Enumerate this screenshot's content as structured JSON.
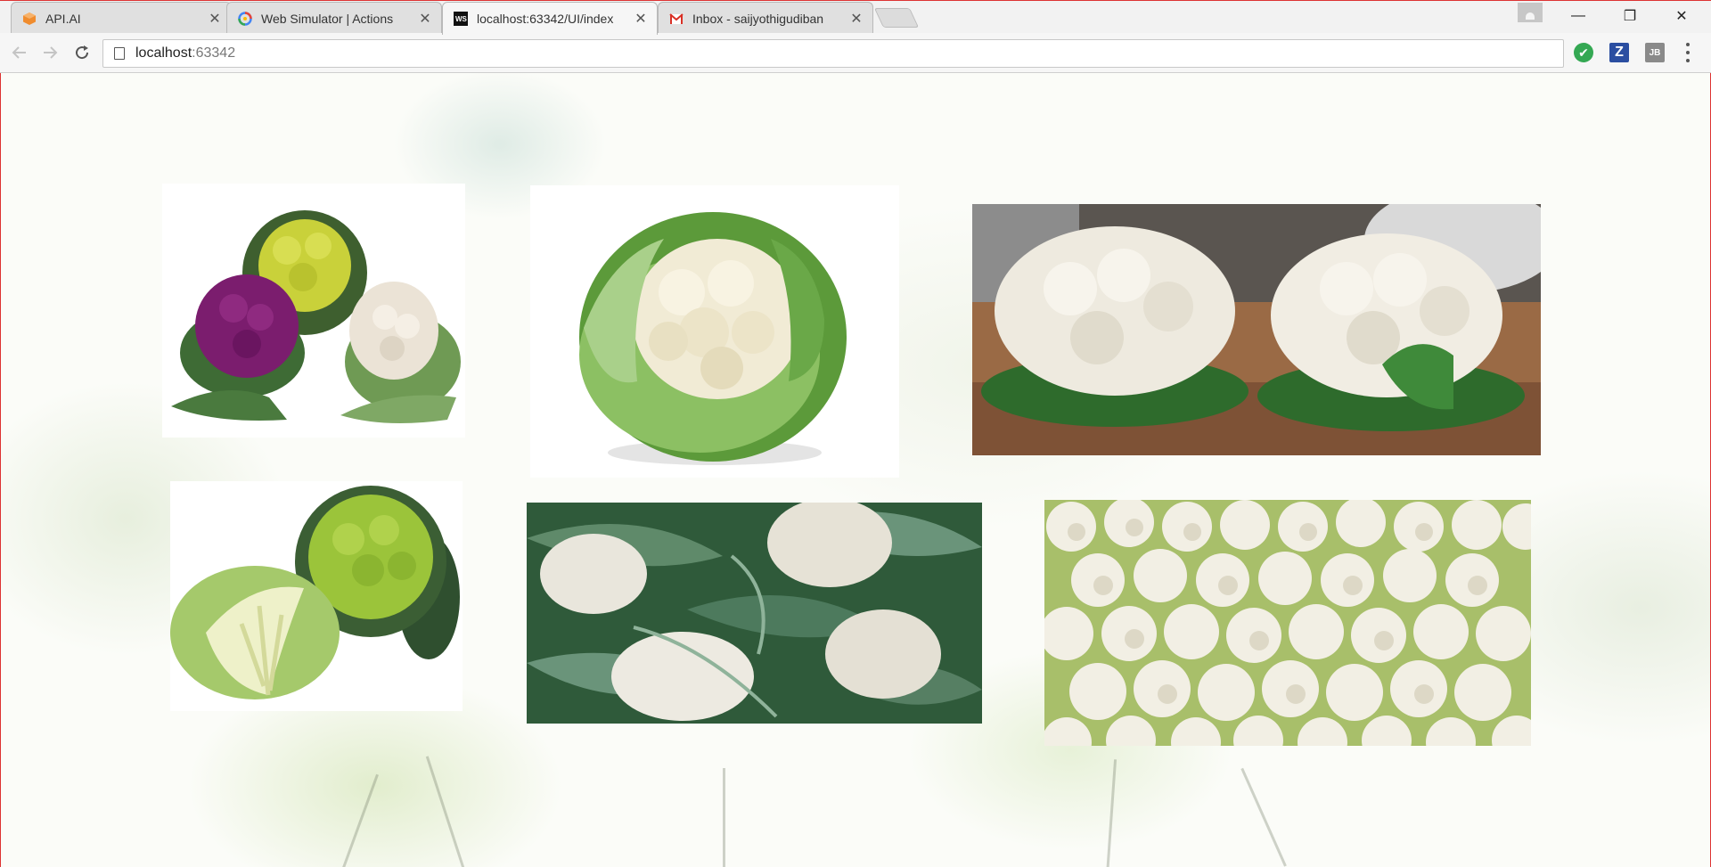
{
  "browser": {
    "tabs": [
      {
        "title": "API.AI",
        "icon": "api-ai-icon",
        "active": false
      },
      {
        "title": "Web Simulator | Actions",
        "icon": "google-icon",
        "active": false
      },
      {
        "title": "localhost:63342/UI/index",
        "icon": "webstorm-icon",
        "active": true
      },
      {
        "title": "Inbox - saijyothigudiban",
        "icon": "gmail-icon",
        "active": false
      }
    ],
    "address": {
      "host": "localhost",
      "port": ":63342"
    },
    "extensions": [
      {
        "name": "check-extension-icon",
        "label": "✔"
      },
      {
        "name": "z-extension-icon",
        "label": "Z"
      },
      {
        "name": "jb-extension-icon",
        "label": "JB"
      }
    ],
    "window_controls": {
      "minimize": "—",
      "restore": "❐",
      "close": "✕"
    }
  },
  "gallery": {
    "images": [
      {
        "name": "cauliflower-varieties-image",
        "subject": "purple, green and white cauliflowers"
      },
      {
        "name": "single-cauliflower-image",
        "subject": "single white cauliflower with leaves"
      },
      {
        "name": "two-cauliflowers-on-board-image",
        "subject": "two cauliflowers on a wooden board"
      },
      {
        "name": "green-romanesco-image",
        "subject": "green cauliflower halved"
      },
      {
        "name": "cauliflower-field-image",
        "subject": "cauliflowers growing among leaves"
      },
      {
        "name": "cauliflower-pile-image",
        "subject": "pile of cauliflower heads"
      }
    ]
  },
  "colors": {
    "cauli_white": "#f3efdf",
    "cauli_shadow": "#d9d2b8",
    "leaf_green": "#5c9a3a",
    "leaf_dark": "#2e5a2c",
    "purple": "#7b1d6e",
    "yellow_green": "#c9d13a",
    "lime": "#8cc63f",
    "wood": "#8a5a3a"
  }
}
